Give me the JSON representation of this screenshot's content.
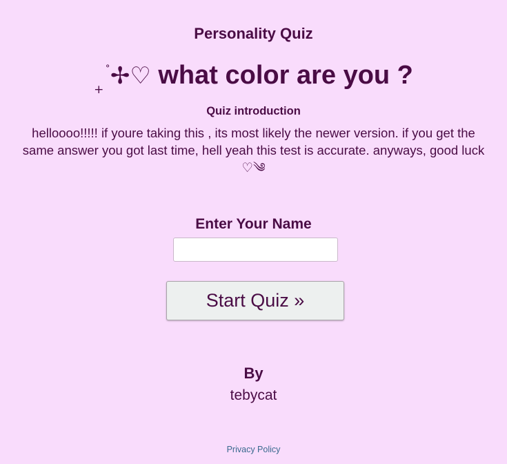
{
  "quiz": {
    "category": "Personality Quiz",
    "title_decoration_sub": "+",
    "title_decoration_sup": "˚",
    "title_decoration_main": "✢♡",
    "title_text": "what color are you ?",
    "intro_heading": "Quiz introduction",
    "intro_text": "helloooo!!!!! if youre taking this , its most likely the newer version. if you get the same answer you got last time, hell yeah this test is accurate. anyways, good luck ♡༄"
  },
  "form": {
    "name_label": "Enter Your Name",
    "name_value": "",
    "name_placeholder": "",
    "start_button_label": "Start Quiz »"
  },
  "footer": {
    "by_label": "By",
    "author": "tebycat",
    "privacy_link": "Privacy Policy"
  },
  "colors": {
    "background": "#f9dcfc",
    "text": "#4a0c45",
    "button_background": "#edf0ef",
    "link": "#3a6a8f"
  }
}
